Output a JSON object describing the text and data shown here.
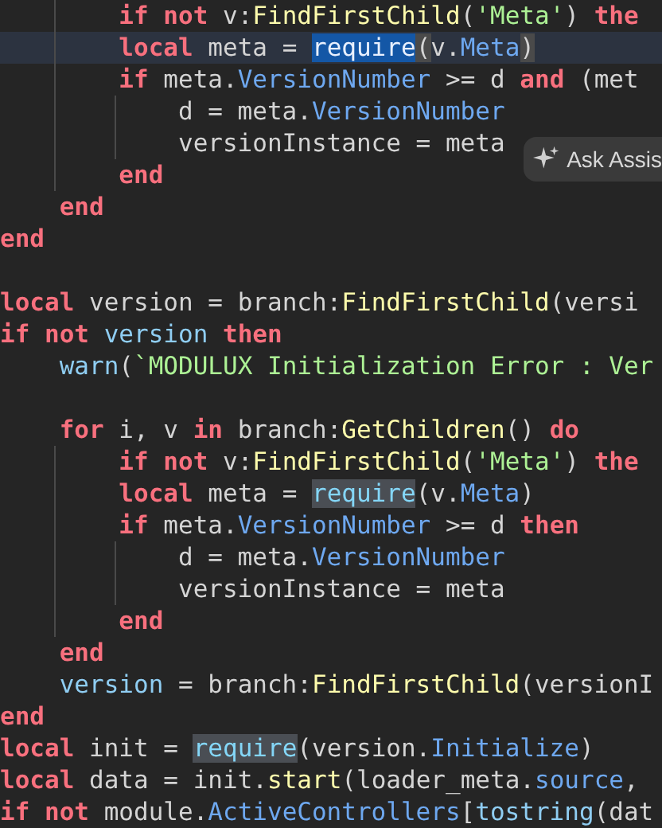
{
  "editor": {
    "lines": [
      {
        "current": false,
        "tokens": [
          {
            "text": "        if not",
            "kind": "keyword"
          },
          {
            "text": " v:",
            "kind": "ident"
          },
          {
            "text": "FindFirstChild",
            "kind": "method"
          },
          {
            "text": "(",
            "kind": "ident"
          },
          {
            "text": "'Meta'",
            "kind": "string"
          },
          {
            "text": ") ",
            "kind": "ident"
          },
          {
            "text": "the",
            "kind": "keyword"
          }
        ]
      },
      {
        "current": true,
        "tokens": [
          {
            "text": "        local",
            "kind": "keyword"
          },
          {
            "text": " meta = ",
            "kind": "ident"
          },
          {
            "text": "require",
            "kind": "builtin",
            "selected": true
          },
          {
            "text": "(",
            "kind": "ident",
            "bracket_match": true
          },
          {
            "text": "v.",
            "kind": "ident"
          },
          {
            "text": "Meta",
            "kind": "property"
          },
          {
            "text": ")",
            "kind": "ident",
            "bracket_match": true
          }
        ]
      },
      {
        "current": false,
        "tokens": [
          {
            "text": "        if",
            "kind": "keyword"
          },
          {
            "text": " meta.",
            "kind": "ident"
          },
          {
            "text": "VersionNumber",
            "kind": "property"
          },
          {
            "text": " >= d ",
            "kind": "ident"
          },
          {
            "text": "and",
            "kind": "keyword"
          },
          {
            "text": " (met",
            "kind": "ident"
          }
        ]
      },
      {
        "current": false,
        "tokens": [
          {
            "text": "            d = meta.",
            "kind": "ident"
          },
          {
            "text": "VersionNumber",
            "kind": "property"
          }
        ]
      },
      {
        "current": false,
        "tokens": [
          {
            "text": "            versionInstance = meta",
            "kind": "ident"
          }
        ]
      },
      {
        "current": false,
        "tokens": [
          {
            "text": "        end",
            "kind": "keyword"
          }
        ]
      },
      {
        "current": false,
        "tokens": [
          {
            "text": "    end",
            "kind": "keyword"
          }
        ]
      },
      {
        "current": false,
        "tokens": [
          {
            "text": "end",
            "kind": "keyword"
          }
        ]
      },
      {
        "current": false
      },
      {
        "current": false,
        "tokens": [
          {
            "text": "local",
            "kind": "keyword"
          },
          {
            "text": " version = branch:",
            "kind": "ident"
          },
          {
            "text": "FindFirstChild",
            "kind": "method"
          },
          {
            "text": "(versi",
            "kind": "ident"
          }
        ]
      },
      {
        "current": false,
        "tokens": [
          {
            "text": "if not",
            "kind": "keyword"
          },
          {
            "text": " version ",
            "kind": "global"
          },
          {
            "text": "then",
            "kind": "keyword"
          }
        ]
      },
      {
        "current": false,
        "tokens": [
          {
            "text": "    warn",
            "kind": "global"
          },
          {
            "text": "(",
            "kind": "ident"
          },
          {
            "text": "`MODULUX Initialization Error : Ver",
            "kind": "string"
          }
        ]
      },
      {
        "current": false
      },
      {
        "current": false,
        "tokens": [
          {
            "text": "    for",
            "kind": "keyword"
          },
          {
            "text": " i, v ",
            "kind": "ident"
          },
          {
            "text": "in",
            "kind": "keyword"
          },
          {
            "text": " branch:",
            "kind": "ident"
          },
          {
            "text": "GetChildren",
            "kind": "method"
          },
          {
            "text": "() ",
            "kind": "ident"
          },
          {
            "text": "do",
            "kind": "keyword"
          }
        ]
      },
      {
        "current": false,
        "tokens": [
          {
            "text": "        if not",
            "kind": "keyword"
          },
          {
            "text": " v:",
            "kind": "ident"
          },
          {
            "text": "FindFirstChild",
            "kind": "method"
          },
          {
            "text": "(",
            "kind": "ident"
          },
          {
            "text": "'Meta'",
            "kind": "string"
          },
          {
            "text": ") ",
            "kind": "ident"
          },
          {
            "text": "the",
            "kind": "keyword"
          }
        ]
      },
      {
        "current": false,
        "tokens": [
          {
            "text": "        local",
            "kind": "keyword"
          },
          {
            "text": " meta = ",
            "kind": "ident"
          },
          {
            "text": "require",
            "kind": "builtin",
            "occurrence": true
          },
          {
            "text": "(v.",
            "kind": "ident"
          },
          {
            "text": "Meta",
            "kind": "property"
          },
          {
            "text": ")",
            "kind": "ident"
          }
        ]
      },
      {
        "current": false,
        "tokens": [
          {
            "text": "        if",
            "kind": "keyword"
          },
          {
            "text": " meta.",
            "kind": "ident"
          },
          {
            "text": "VersionNumber",
            "kind": "property"
          },
          {
            "text": " >= d ",
            "kind": "ident"
          },
          {
            "text": "then",
            "kind": "keyword"
          }
        ]
      },
      {
        "current": false,
        "tokens": [
          {
            "text": "            d = meta.",
            "kind": "ident"
          },
          {
            "text": "VersionNumber",
            "kind": "property"
          }
        ]
      },
      {
        "current": false,
        "tokens": [
          {
            "text": "            versionInstance = meta",
            "kind": "ident"
          }
        ]
      },
      {
        "current": false,
        "tokens": [
          {
            "text": "        end",
            "kind": "keyword"
          }
        ]
      },
      {
        "current": false,
        "tokens": [
          {
            "text": "    end",
            "kind": "keyword"
          }
        ]
      },
      {
        "current": false,
        "tokens": [
          {
            "text": "    version",
            "kind": "global"
          },
          {
            "text": " = branch:",
            "kind": "ident"
          },
          {
            "text": "FindFirstChild",
            "kind": "method"
          },
          {
            "text": "(versionI",
            "kind": "ident"
          }
        ]
      },
      {
        "current": false,
        "tokens": [
          {
            "text": "end",
            "kind": "keyword"
          }
        ]
      },
      {
        "current": false,
        "tokens": [
          {
            "text": "local",
            "kind": "keyword"
          },
          {
            "text": " init = ",
            "kind": "ident"
          },
          {
            "text": "require",
            "kind": "builtin",
            "occurrence": true
          },
          {
            "text": "(version.",
            "kind": "ident"
          },
          {
            "text": "Initialize",
            "kind": "property"
          },
          {
            "text": ")",
            "kind": "ident"
          }
        ]
      },
      {
        "current": false,
        "tokens": [
          {
            "text": "local",
            "kind": "keyword"
          },
          {
            "text": " data = init.",
            "kind": "ident"
          },
          {
            "text": "start",
            "kind": "method"
          },
          {
            "text": "(loader_meta.",
            "kind": "ident"
          },
          {
            "text": "source",
            "kind": "property"
          },
          {
            "text": ",",
            "kind": "ident"
          }
        ]
      },
      {
        "current": false,
        "tokens": [
          {
            "text": "if not",
            "kind": "keyword"
          },
          {
            "text": " module.",
            "kind": "ident"
          },
          {
            "text": "ActiveControllers",
            "kind": "property"
          },
          {
            "text": "[",
            "kind": "ident"
          },
          {
            "text": "tostring",
            "kind": "global"
          },
          {
            "text": "(dat",
            "kind": "ident"
          }
        ]
      }
    ]
  },
  "assistant_popup": {
    "label": "Ask Assis"
  }
}
